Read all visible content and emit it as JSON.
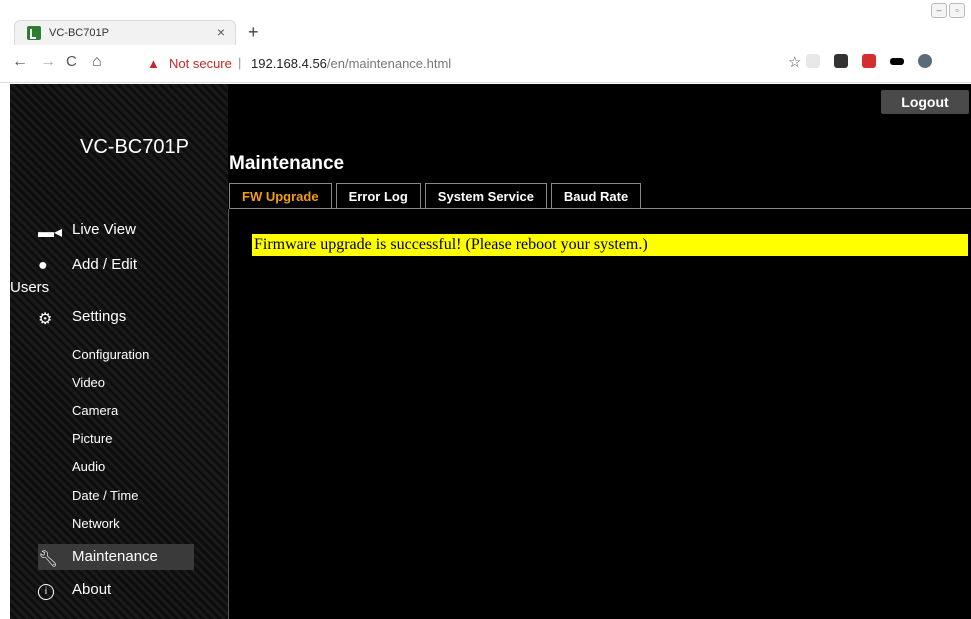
{
  "browser": {
    "tab_title": "VC-BC701P",
    "tab_close": "×",
    "new_tab": "+",
    "nav_back": "←",
    "nav_forward": "→",
    "nav_reload": "C",
    "nav_home": "⌂",
    "not_secure": "Not secure",
    "separator": "|",
    "url_host": "192.168.4.56",
    "url_path": "/en/maintenance.html",
    "star": "☆"
  },
  "app": {
    "brand": "VC-BC701P",
    "logout_label": "Logout",
    "page_title": "Maintenance"
  },
  "sidebar": {
    "live_view": "Live View",
    "add_edit_users": "Add / Edit",
    "users": "Users",
    "settings": "Settings",
    "sub_items": [
      "Configuration",
      "Video",
      "Camera",
      "Picture",
      "Audio",
      "Date / Time",
      "Network"
    ],
    "maintenance": "Maintenance",
    "about": "About"
  },
  "tabs": [
    "FW Upgrade",
    "Error Log",
    "System Service",
    "Baud Rate"
  ],
  "active_tab": "FW Upgrade",
  "message": "Firmware upgrade is successful! (Please reboot your system.)",
  "colors": {
    "active_tab": "#f39c12",
    "alert_bg": "#ffff00",
    "not_secure": "#c62828"
  }
}
